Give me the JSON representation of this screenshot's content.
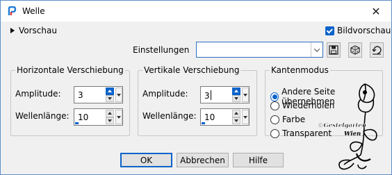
{
  "window": {
    "title": "Welle"
  },
  "top": {
    "preview_label": "Vorschau",
    "image_preview_label": "Bildvorschau",
    "image_preview_checked": true,
    "settings_label": "Einstellungen",
    "settings_value": ""
  },
  "horizontal": {
    "legend": "Horizontale Verschiebung",
    "amplitude_label": "Amplitude:",
    "amplitude_value": "3",
    "wavelength_label": "Wellenlänge:",
    "wavelength_value": "10"
  },
  "vertical": {
    "legend": "Vertikale Verschiebung",
    "amplitude_label": "Amplitude:",
    "amplitude_value": "3",
    "wavelength_label": "Wellenlänge:",
    "wavelength_value": "10"
  },
  "edge": {
    "legend": "Kantenmodus",
    "options": [
      "Andere Seite übernehmen",
      "Wiederholen",
      "Farbe",
      "Transparent"
    ],
    "selected": "Andere Seite übernehmen"
  },
  "watermark": {
    "line1": "©Gestelgarten",
    "line2": "Wien"
  },
  "buttons": {
    "ok": "OK",
    "cancel": "Abbrechen",
    "help": "Hilfe"
  },
  "colors": {
    "accent": "#0b63c9",
    "border": "#5a8fc8",
    "background": "#f0f0f0"
  }
}
